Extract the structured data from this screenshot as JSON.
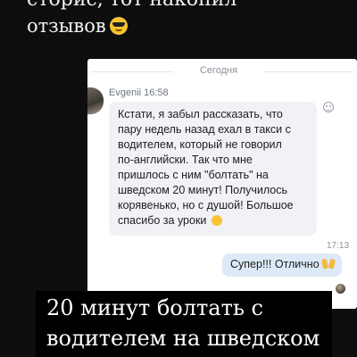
{
  "story": {
    "top_text": {
      "line1": "сторис, тот накопил",
      "line2": "отзывов",
      "emoji": "sunglasses-emoji"
    },
    "caption": {
      "line1": "20 минут болтать с",
      "line2": "водителем на шведском"
    }
  },
  "chat": {
    "date_divider": "Сегодня",
    "incoming": {
      "sender": "Evgenii",
      "time": "16:58",
      "text": "Кстати, я забыл рассказать, что\nпару недель назад ехал в такси с\nводителем, который не говорил\nпо-английски. Так что мне\nпришлось с ним \"болтать\" на\nшведском 20 минут! Получилось\nкорявенько, но с душой! Большое\nспасибо за уроки",
      "emoji": "smiling-face-emoji",
      "reaction_icon": "add-reaction-icon"
    },
    "outgoing": {
      "time": "17:13",
      "text": "Супер!!! Отлично",
      "emoji": "raising-hands-emoji"
    }
  },
  "colors": {
    "background": "#0d0d0d",
    "incoming_bubble": "#f0f2f5",
    "outgoing_bubble": "#dde9f7",
    "meta_text": "#8a929a"
  }
}
